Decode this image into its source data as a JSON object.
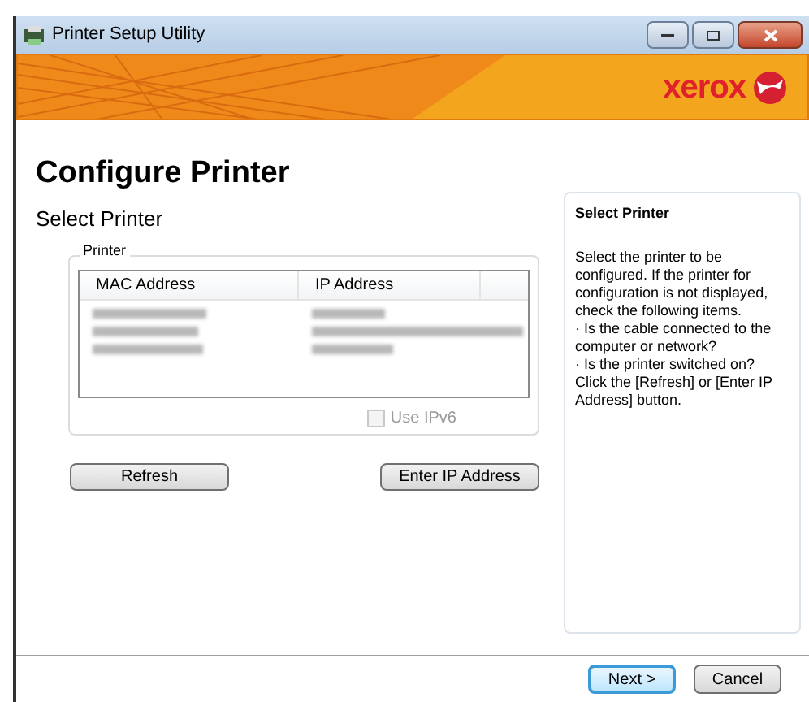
{
  "window": {
    "title": "Printer Setup Utility"
  },
  "banner": {
    "brand": "xerox"
  },
  "heading": "Configure Printer",
  "subheading": "Select Printer",
  "group": {
    "label": "Printer",
    "table": {
      "columns": [
        "MAC Address",
        "IP Address"
      ],
      "rows": [
        {
          "kind": "blurred"
        },
        {
          "kind": "blurred"
        },
        {
          "kind": "blurred"
        }
      ]
    },
    "ipv6": {
      "label": "Use IPv6",
      "checked": false,
      "disabled": true
    }
  },
  "buttons": [
    {
      "label": "Refresh"
    },
    {
      "label": "Enter IP Address"
    }
  ],
  "help": {
    "title": "Select Printer",
    "lines": [
      "Select the printer to be configured. If the printer for configuration is not displayed, check the following items.",
      "· Is the cable connected to the computer or network?",
      "· Is the printer switched on?",
      "Click the [Refresh] or [Enter IP Address] button."
    ]
  },
  "footer": [
    {
      "label": "Next >",
      "default": true
    },
    {
      "label": "Cancel",
      "default": false
    }
  ]
}
